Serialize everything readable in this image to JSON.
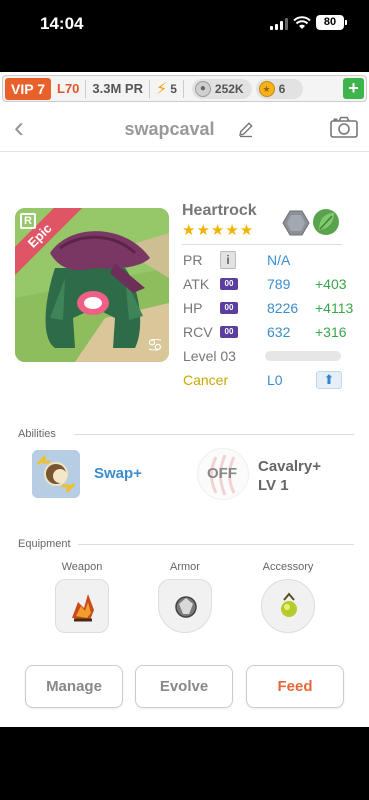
{
  "status_bar": {
    "time": "14:04",
    "battery": "80"
  },
  "resource_bar": {
    "vip": "VIP 7",
    "level": "L70",
    "power": "3.3M PR",
    "energy": "5",
    "food": "252K",
    "coins": "6",
    "add_label": "+"
  },
  "header": {
    "pet_name": "swapcaval"
  },
  "portrait": {
    "rarity_badge": "R",
    "tier": "Epic",
    "zodiac_symbol": "♋"
  },
  "monster": {
    "name": "Heartrock",
    "stars": "★★★★★",
    "elements": [
      "rock",
      "leaf"
    ]
  },
  "stats": {
    "pr_label": "PR",
    "pr_info": "i",
    "pr_value": "N/A",
    "rows": [
      {
        "label": "ATK",
        "badge": "00",
        "value": "789",
        "bonus": "+403"
      },
      {
        "label": "HP",
        "badge": "00",
        "value": "8226",
        "bonus": "+4113"
      },
      {
        "label": "RCV",
        "badge": "00",
        "value": "632",
        "bonus": "+316"
      }
    ],
    "level_label": "Level 03",
    "level_progress": 0,
    "sign": "Cancer",
    "sign_level": "L0",
    "upgrade_icon": "⬆"
  },
  "abilities": {
    "title": "Abilities",
    "items": [
      {
        "name": "Swap+"
      },
      {
        "state": "OFF",
        "name_line1": "Cavalry+",
        "name_line2": "LV 1"
      }
    ]
  },
  "equipment": {
    "title": "Equipment",
    "slots": [
      {
        "label": "Weapon"
      },
      {
        "label": "Armor"
      },
      {
        "label": "Accessory"
      }
    ]
  },
  "actions": {
    "manage": "Manage",
    "evolve": "Evolve",
    "feed": "Feed"
  },
  "colors": {
    "vip": "#e8602a",
    "blue_value": "#3a8ed0",
    "green_bonus": "#3aa54a",
    "feed": "#e6683a"
  }
}
